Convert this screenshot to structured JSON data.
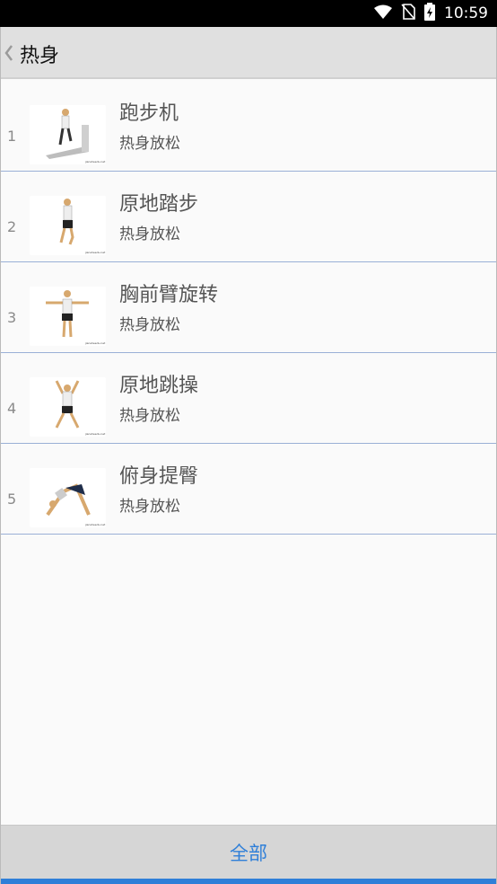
{
  "status_bar": {
    "time": "10:59",
    "icons": [
      "wifi-icon",
      "no-sim-icon",
      "battery-charging-icon"
    ]
  },
  "header": {
    "back_icon": "chevron-left-icon",
    "title": "热身"
  },
  "list": {
    "items": [
      {
        "number": "1",
        "title": "跑步机",
        "subtitle": "热身放松",
        "thumb_icon": "treadmill-exercise-icon"
      },
      {
        "number": "2",
        "title": "原地踏步",
        "subtitle": "热身放松",
        "thumb_icon": "march-in-place-icon"
      },
      {
        "number": "3",
        "title": "胸前臂旋转",
        "subtitle": "热身放松",
        "thumb_icon": "arm-circles-icon"
      },
      {
        "number": "4",
        "title": "原地跳操",
        "subtitle": "热身放松",
        "thumb_icon": "jumping-jacks-icon"
      },
      {
        "number": "5",
        "title": "俯身提臀",
        "subtitle": "热身放松",
        "thumb_icon": "downward-dog-icon"
      }
    ]
  },
  "footer": {
    "label": "全部"
  },
  "colors": {
    "accent": "#2f7fd8",
    "header_bg": "#e0e0e0",
    "footer_bg": "#d6d6d6",
    "divider": "#9ab0d6"
  }
}
